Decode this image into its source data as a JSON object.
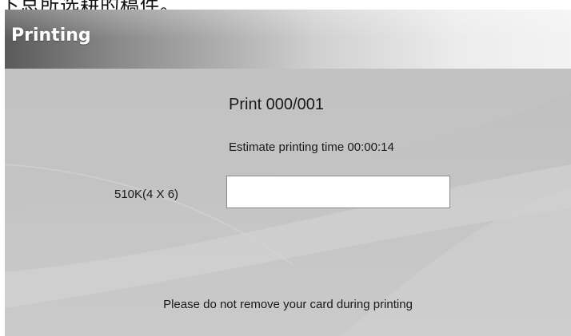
{
  "header_caption": "下总所选耕的稿件。",
  "dialog": {
    "title": "Printing",
    "print_count": "Print 000/001",
    "estimate_label": "Estimate printing time",
    "estimate_time": "00:00:14",
    "size_label": "510K(4 X 6)",
    "progress_fraction": 0,
    "notice": "Please do not remove your card during printing"
  },
  "colors": {
    "background": "#bdbdbd",
    "title_text": "#ffffff",
    "text": "#1a1a1a",
    "progress_box": "#ffffff"
  }
}
